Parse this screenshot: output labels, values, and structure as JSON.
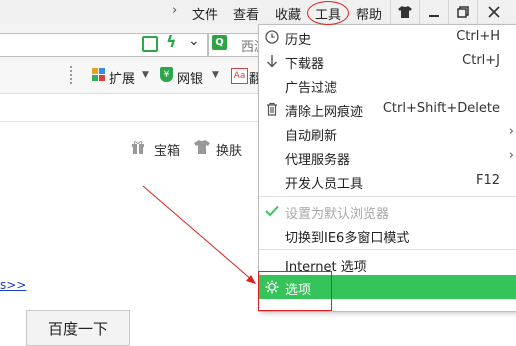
{
  "titlebar": {
    "menu": [
      "文件",
      "查看",
      "收藏",
      "工具",
      "帮助"
    ],
    "chevron": "›"
  },
  "address": {
    "search_text": "西游"
  },
  "toolbar": {
    "items": [
      "扩展",
      "网银",
      "翻"
    ]
  },
  "page": {
    "links": [
      "宝箱",
      "换肤"
    ],
    "more_link": "s>>",
    "search_button": "百度一下"
  },
  "menu": {
    "history_label": "历史",
    "history_shortcut": "Ctrl+H",
    "downloads_label": "下载器",
    "downloads_shortcut": "Ctrl+J",
    "adfilter_label": "广告过滤",
    "clear_label": "清除上网痕迹",
    "clear_shortcut": "Ctrl+Shift+Delete",
    "autorefresh_label": "自动刷新",
    "proxy_label": "代理服务器",
    "devtools_label": "开发人员工具",
    "devtools_shortcut": "F12",
    "setdefault_label": "设置为默认浏览器",
    "ie6_label": "切换到IE6多窗口模式",
    "internet_label": "Internet 选项",
    "options_label": "选项"
  },
  "colors": {
    "highlight": "#35c45a",
    "annotation": "#e02020",
    "accent_green": "#2aa84a"
  },
  "icons": [
    "chevron-right-icon",
    "shirt-icon",
    "minimize-icon",
    "restore-icon",
    "close-icon",
    "share-icon",
    "lightning-icon",
    "chevron-down-icon",
    "search-engine-icon",
    "extensions-icon",
    "bank-icon",
    "translate-icon",
    "gift-icon",
    "clock-icon",
    "download-arrow-icon",
    "trash-icon",
    "checkmark-icon",
    "gear-icon",
    "submenu-arrow-icon"
  ]
}
